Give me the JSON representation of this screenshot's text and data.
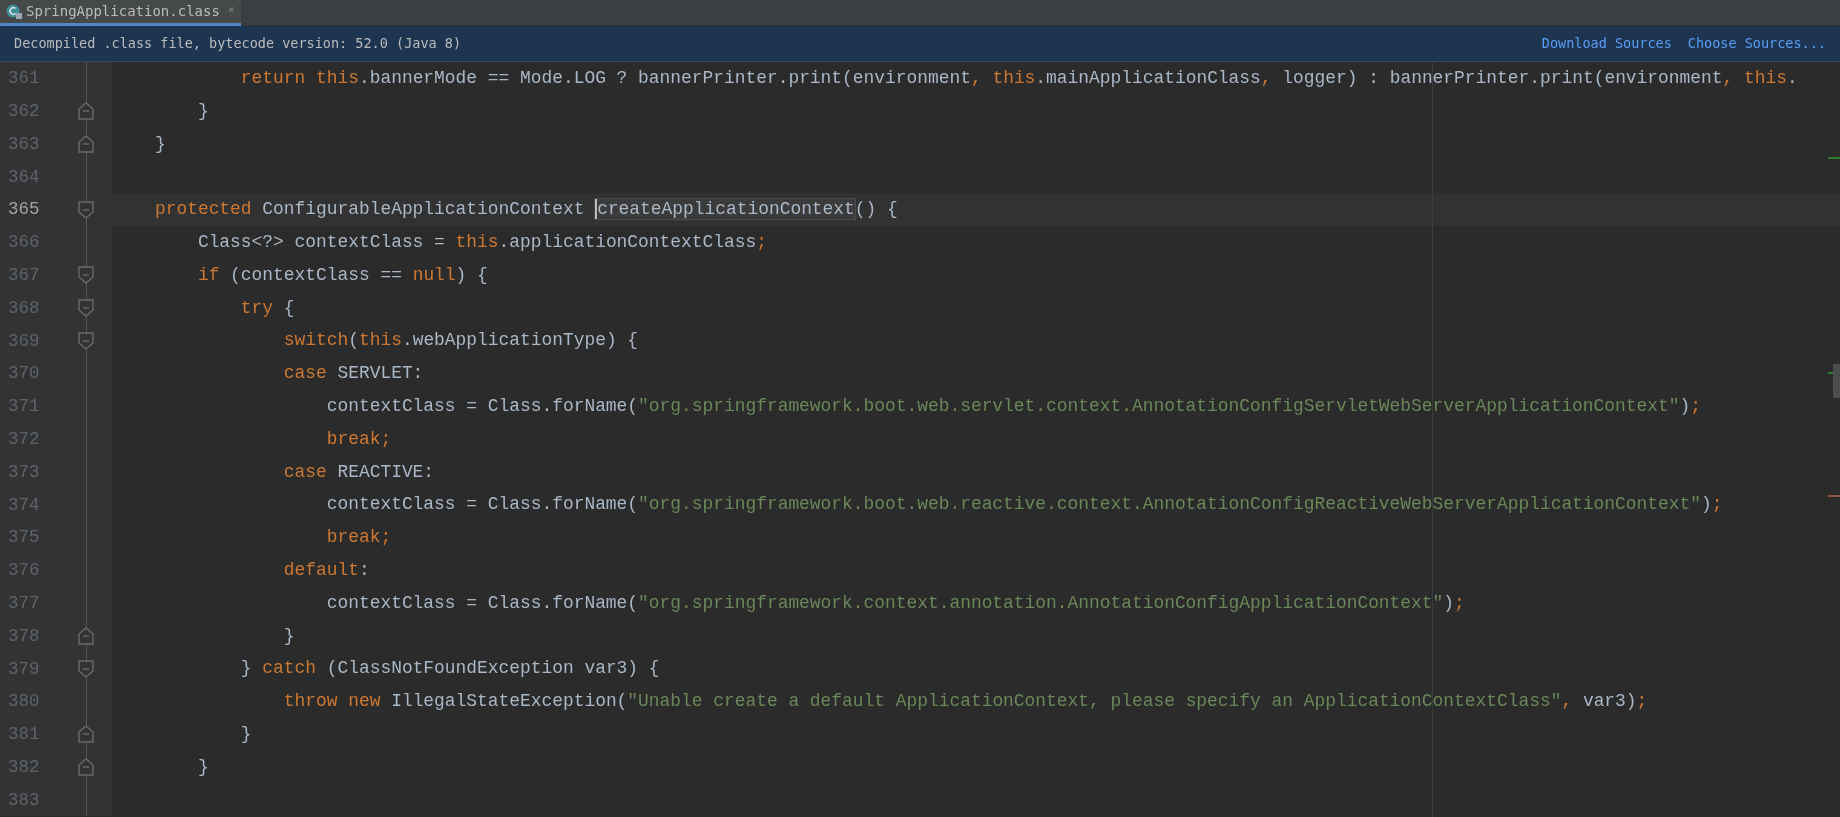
{
  "tab": {
    "label": "SpringApplication.class",
    "close": "×",
    "selected": true
  },
  "banner": {
    "message": "Decompiled .class file, bytecode version: 52.0 (Java 8)",
    "links": [
      "Download Sources",
      "Choose Sources..."
    ]
  },
  "lines": [
    {
      "number": "361",
      "current": false,
      "tokens": [
        {
          "kind": "kw",
          "text": "            return "
        },
        {
          "kind": "kw",
          "text": "this"
        },
        {
          "kind": "text",
          "text": ".bannerMode == Mode.LOG ? bannerPrinter.print(environment"
        },
        {
          "kind": "punct",
          "text": ", "
        },
        {
          "kind": "kw",
          "text": "this"
        },
        {
          "kind": "text",
          "text": ".mainApplicationClass"
        },
        {
          "kind": "punct",
          "text": ","
        },
        {
          "kind": "text",
          "text": " logger) : bannerPrinter.print(environment"
        },
        {
          "kind": "punct",
          "text": ", "
        },
        {
          "kind": "kw",
          "text": "this"
        },
        {
          "kind": "text",
          "text": "."
        }
      ]
    },
    {
      "number": "362",
      "current": false,
      "fold": {
        "kind": "end",
        "expanded": true
      },
      "tokens": [
        {
          "kind": "text",
          "text": "        }"
        }
      ]
    },
    {
      "number": "363",
      "current": false,
      "fold": {
        "kind": "end",
        "expanded": true
      },
      "tokens": [
        {
          "kind": "text",
          "text": "    }"
        }
      ]
    },
    {
      "number": "364",
      "current": false
    },
    {
      "number": "365",
      "current": true,
      "fold": {
        "kind": "start",
        "expanded": true
      },
      "tokens": [
        {
          "kind": "kw",
          "text": "    protected"
        },
        {
          "kind": "text",
          "text": " ConfigurableApplicationContext "
        },
        {
          "kind": "text",
          "text": "createApplicationContext",
          "caret": true
        },
        {
          "kind": "text",
          "text": "() {"
        }
      ]
    },
    {
      "number": "366",
      "current": false,
      "tokens": [
        {
          "kind": "text",
          "text": "        Class<?> contextClass = "
        },
        {
          "kind": "kw",
          "text": "this"
        },
        {
          "kind": "text",
          "text": ".applicationContextClass"
        },
        {
          "kind": "punct",
          "text": ";"
        }
      ]
    },
    {
      "number": "367",
      "current": false,
      "fold": {
        "kind": "start",
        "expanded": true
      },
      "tokens": [
        {
          "kind": "kw",
          "text": "        if"
        },
        {
          "kind": "text",
          "text": " (contextClass == "
        },
        {
          "kind": "kw",
          "text": "null"
        },
        {
          "kind": "text",
          "text": ") {"
        }
      ]
    },
    {
      "number": "368",
      "current": false,
      "fold": {
        "kind": "start",
        "expanded": true
      },
      "tokens": [
        {
          "kind": "kw",
          "text": "            try"
        },
        {
          "kind": "text",
          "text": " {"
        }
      ]
    },
    {
      "number": "369",
      "current": false,
      "fold": {
        "kind": "start",
        "expanded": true
      },
      "tokens": [
        {
          "kind": "kw",
          "text": "                switch"
        },
        {
          "kind": "text",
          "text": "("
        },
        {
          "kind": "kw",
          "text": "this"
        },
        {
          "kind": "text",
          "text": ".webApplicationType) {"
        }
      ]
    },
    {
      "number": "370",
      "current": false,
      "tokens": [
        {
          "kind": "kw",
          "text": "                case"
        },
        {
          "kind": "text",
          "text": " SERVLET:"
        }
      ]
    },
    {
      "number": "371",
      "current": false,
      "tokens": [
        {
          "kind": "text",
          "text": "                    contextClass = Class.forName("
        },
        {
          "kind": "str",
          "text": "\"org.springframework.boot.web.servlet.context.AnnotationConfigServletWebServerApplicationContext\""
        },
        {
          "kind": "text",
          "text": ")"
        },
        {
          "kind": "punct",
          "text": ";"
        }
      ]
    },
    {
      "number": "372",
      "current": false,
      "tokens": [
        {
          "kind": "kw",
          "text": "                    break"
        },
        {
          "kind": "punct",
          "text": ";"
        }
      ]
    },
    {
      "number": "373",
      "current": false,
      "tokens": [
        {
          "kind": "kw",
          "text": "                case"
        },
        {
          "kind": "text",
          "text": " REACTIVE:"
        }
      ]
    },
    {
      "number": "374",
      "current": false,
      "tokens": [
        {
          "kind": "text",
          "text": "                    contextClass = Class.forName("
        },
        {
          "kind": "str",
          "text": "\"org.springframework.boot.web.reactive.context.AnnotationConfigReactiveWebServerApplicationContext\""
        },
        {
          "kind": "text",
          "text": ")"
        },
        {
          "kind": "punct",
          "text": ";"
        }
      ]
    },
    {
      "number": "375",
      "current": false,
      "tokens": [
        {
          "kind": "kw",
          "text": "                    break"
        },
        {
          "kind": "punct",
          "text": ";"
        }
      ]
    },
    {
      "number": "376",
      "current": false,
      "tokens": [
        {
          "kind": "kw",
          "text": "                default"
        },
        {
          "kind": "text",
          "text": ":"
        }
      ]
    },
    {
      "number": "377",
      "current": false,
      "tokens": [
        {
          "kind": "text",
          "text": "                    contextClass = Class.forName("
        },
        {
          "kind": "str",
          "text": "\"org.springframework.context.annotation.AnnotationConfigApplicationContext\""
        },
        {
          "kind": "text",
          "text": ")"
        },
        {
          "kind": "punct",
          "text": ";"
        }
      ]
    },
    {
      "number": "378",
      "current": false,
      "fold": {
        "kind": "end",
        "expanded": true
      },
      "tokens": [
        {
          "kind": "text",
          "text": "                }"
        }
      ]
    },
    {
      "number": "379",
      "current": false,
      "fold": {
        "kind": "start",
        "expanded": true
      },
      "tokens": [
        {
          "kind": "text",
          "text": "            } "
        },
        {
          "kind": "kw",
          "text": "catch"
        },
        {
          "kind": "text",
          "text": " (ClassNotFoundException var3) {"
        }
      ]
    },
    {
      "number": "380",
      "current": false,
      "tokens": [
        {
          "kind": "kw",
          "text": "                throw "
        },
        {
          "kind": "kw",
          "text": "new"
        },
        {
          "kind": "text",
          "text": " IllegalStateException("
        },
        {
          "kind": "str",
          "text": "\"Unable create a default ApplicationContext, please specify an ApplicationContextClass\""
        },
        {
          "kind": "punct",
          "text": ","
        },
        {
          "kind": "text",
          "text": " var3)"
        },
        {
          "kind": "punct",
          "text": ";"
        }
      ]
    },
    {
      "number": "381",
      "current": false,
      "fold": {
        "kind": "end",
        "expanded": true
      },
      "tokens": [
        {
          "kind": "text",
          "text": "            }"
        }
      ]
    },
    {
      "number": "382",
      "current": false,
      "fold": {
        "kind": "end",
        "expanded": true
      },
      "tokens": [
        {
          "kind": "text",
          "text": "        }"
        }
      ]
    },
    {
      "number": "383",
      "current": false
    }
  ]
}
